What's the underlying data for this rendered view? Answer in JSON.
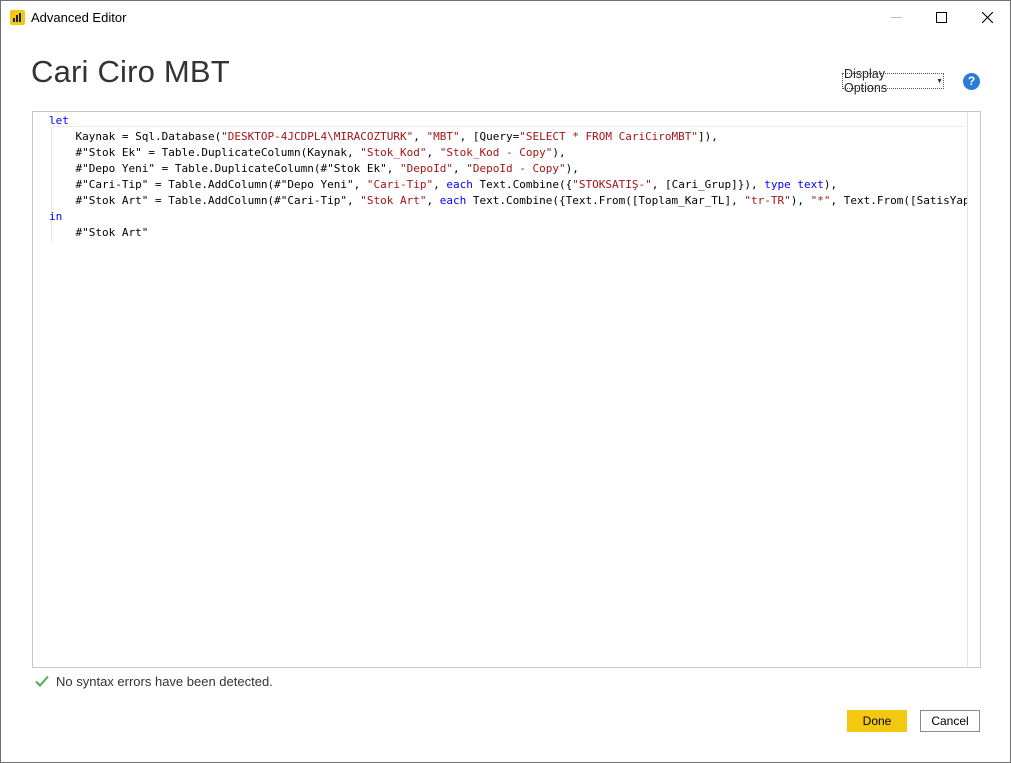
{
  "window": {
    "title": "Advanced Editor",
    "minimize_icon": "minimize-icon",
    "maximize_icon": "maximize-icon",
    "close_icon": "close-icon"
  },
  "header": {
    "query_name": "Cari Ciro MBT",
    "display_options_label": "Display Options",
    "help_icon": "help-icon"
  },
  "editor": {
    "lines": [
      [
        {
          "t": "let",
          "c": "kw"
        }
      ],
      [
        {
          "t": "    Kaynak = Sql.Database("
        },
        {
          "t": "\"DESKTOP-4JCDPL4\\MIRACOZTURK\"",
          "c": "str"
        },
        {
          "t": ", "
        },
        {
          "t": "\"MBT\"",
          "c": "str"
        },
        {
          "t": ", [Query="
        },
        {
          "t": "\"SELECT * FROM CariCiroMBT\"",
          "c": "str"
        },
        {
          "t": "]),"
        }
      ],
      [
        {
          "t": "    #\"Stok Ek\" = Table.DuplicateColumn(Kaynak, "
        },
        {
          "t": "\"Stok_Kod\"",
          "c": "str"
        },
        {
          "t": ", "
        },
        {
          "t": "\"Stok_Kod - Copy\"",
          "c": "str"
        },
        {
          "t": "),"
        }
      ],
      [
        {
          "t": "    #\"Depo Yeni\" = Table.DuplicateColumn(#\"Stok Ek\", "
        },
        {
          "t": "\"DepoId\"",
          "c": "str"
        },
        {
          "t": ", "
        },
        {
          "t": "\"DepoId - Copy\"",
          "c": "str"
        },
        {
          "t": "),"
        }
      ],
      [
        {
          "t": "    #\"Cari-Tip\" = Table.AddColumn(#\"Depo Yeni\", "
        },
        {
          "t": "\"Cari-Tip\"",
          "c": "str"
        },
        {
          "t": ", "
        },
        {
          "t": "each",
          "c": "kw"
        },
        {
          "t": " Text.Combine({"
        },
        {
          "t": "\"STOKSATIŞ-\"",
          "c": "str"
        },
        {
          "t": ", [Cari_Grup]}), "
        },
        {
          "t": "type",
          "c": "kw"
        },
        {
          "t": " "
        },
        {
          "t": "text",
          "c": "kw"
        },
        {
          "t": "),"
        }
      ],
      [
        {
          "t": "    #\"Stok Art\" = Table.AddColumn(#\"Cari-Tip\", "
        },
        {
          "t": "\"Stok Art\"",
          "c": "str"
        },
        {
          "t": ", "
        },
        {
          "t": "each",
          "c": "kw"
        },
        {
          "t": " Text.Combine({Text.From([Toplam_Kar_TL], "
        },
        {
          "t": "\"tr-TR\"",
          "c": "str"
        },
        {
          "t": "), "
        },
        {
          "t": "\"*\"",
          "c": "str"
        },
        {
          "t": ", Text.From([SatisYapan"
        }
      ],
      [
        {
          "t": "in",
          "c": "kw"
        }
      ],
      [
        {
          "t": "    #\"Stok Art\""
        }
      ]
    ]
  },
  "status": {
    "icon": "checkmark-icon",
    "message": "No syntax errors have been detected."
  },
  "footer": {
    "done_label": "Done",
    "cancel_label": "Cancel"
  },
  "colors": {
    "accent": "#f2c811",
    "keyword": "#0000ff",
    "string": "#a31515",
    "success": "#4caf50",
    "help": "#2b7bd6"
  }
}
